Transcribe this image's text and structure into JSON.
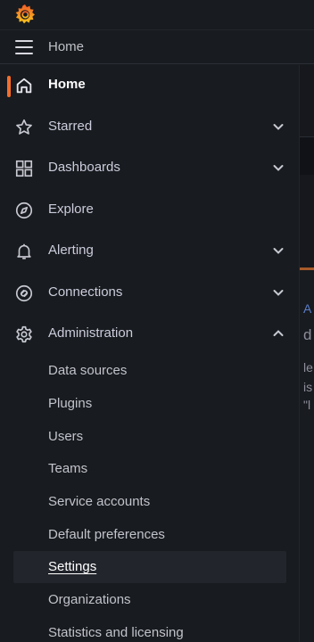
{
  "topbar": {
    "breadcrumb": "Home"
  },
  "nav": {
    "items": [
      {
        "label": "Home",
        "icon": "home-icon",
        "active": true
      },
      {
        "label": "Starred",
        "icon": "star-icon",
        "expandable": true
      },
      {
        "label": "Dashboards",
        "icon": "grid-icon",
        "expandable": true
      },
      {
        "label": "Explore",
        "icon": "compass-icon",
        "expandable": false
      },
      {
        "label": "Alerting",
        "icon": "bell-icon",
        "expandable": true
      },
      {
        "label": "Connections",
        "icon": "connections-icon",
        "expandable": true
      },
      {
        "label": "Administration",
        "icon": "gear-icon",
        "expandable": true,
        "expanded": true
      }
    ],
    "admin_children": [
      {
        "label": "Data sources"
      },
      {
        "label": "Plugins"
      },
      {
        "label": "Users"
      },
      {
        "label": "Teams"
      },
      {
        "label": "Service accounts"
      },
      {
        "label": "Default preferences"
      },
      {
        "label": "Settings",
        "selected": true
      },
      {
        "label": "Organizations"
      },
      {
        "label": "Statistics and licensing"
      }
    ]
  },
  "background": {
    "fragments": [
      "A",
      "d",
      "le",
      "is",
      "\"l"
    ]
  },
  "colors": {
    "accent": "#f46e2a",
    "background": "#181b1f"
  }
}
